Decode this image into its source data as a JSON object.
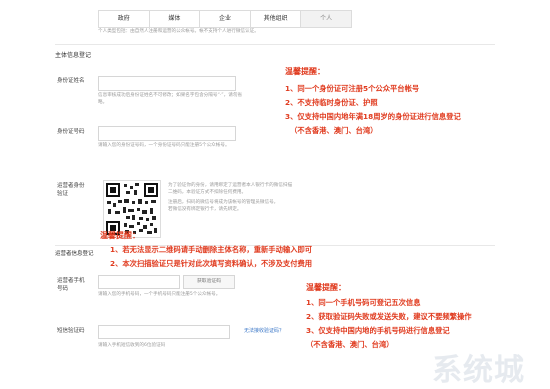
{
  "tabs": [
    "政府",
    "媒体",
    "企业",
    "其他组织",
    "个人"
  ],
  "type_note": "个人类型包括：由自然人注册和运营的公众帐号。帐不支持个人进行微信认证。",
  "section_title": "主体信息登记",
  "fields": {
    "name_label": "身份证姓名",
    "name_note": [
      "信息审核成功后身份证姓名不可修改；如果名字包含分隔号“·”，请勿省略。"
    ],
    "id_label": "身份证号码",
    "id_note": "请输入您的身份证号码，一个身份证号码只能注册5个公众帐号。",
    "admin_verify_label": [
      "运营者身份",
      "验证"
    ],
    "qr_note": [
      "为了验证你的身份，请用绑定了运营者本人银行卡的微信扫描",
      "二维码，本验证方式不扣除任何费用。",
      "注册后，扫码的微信号将成为该帐号的管理员微信号。",
      "若微信没有绑定银行卡，请先绑定。"
    ],
    "admin_info_label": "运营者信息登记",
    "phone_label": [
      "运营者手机",
      "号码"
    ],
    "phone_button": "获取验证码",
    "phone_note": "请输入您的手机号码，一个手机号码只能注册5个公众帐号。",
    "sms_label": "短信验证码",
    "sms_link": "无法接收验证码？",
    "sms_note": "请输入手机短信收到的6位验证码"
  },
  "tip1": {
    "title": "温馨提醒：",
    "lines": [
      "1、同一个身份证可注册5个公众平台帐号",
      "2、不支持临时身份证、护照",
      "3、仅支持中国内地年满18周岁的身份证进行信息登记",
      "（不含香港、澳门、台湾）"
    ]
  },
  "tip2": {
    "title": "温馨提醒：",
    "lines": [
      "1、若无法显示二维码请手动删除主体名称，重新手动输入即可",
      "2、本次扫描验证只是针对此次填写资料确认，不涉及支付费用"
    ]
  },
  "tip3": {
    "title": "温馨提醒：",
    "lines": [
      "1、同一个手机号码可登记五次信息",
      "2、获取验证码失败或发送失败，建议不要频繁操作",
      "3、仅支持中国内地的手机号码进行信息登记",
      "（不含香港、澳门、台湾）"
    ]
  },
  "watermark": "系统城"
}
